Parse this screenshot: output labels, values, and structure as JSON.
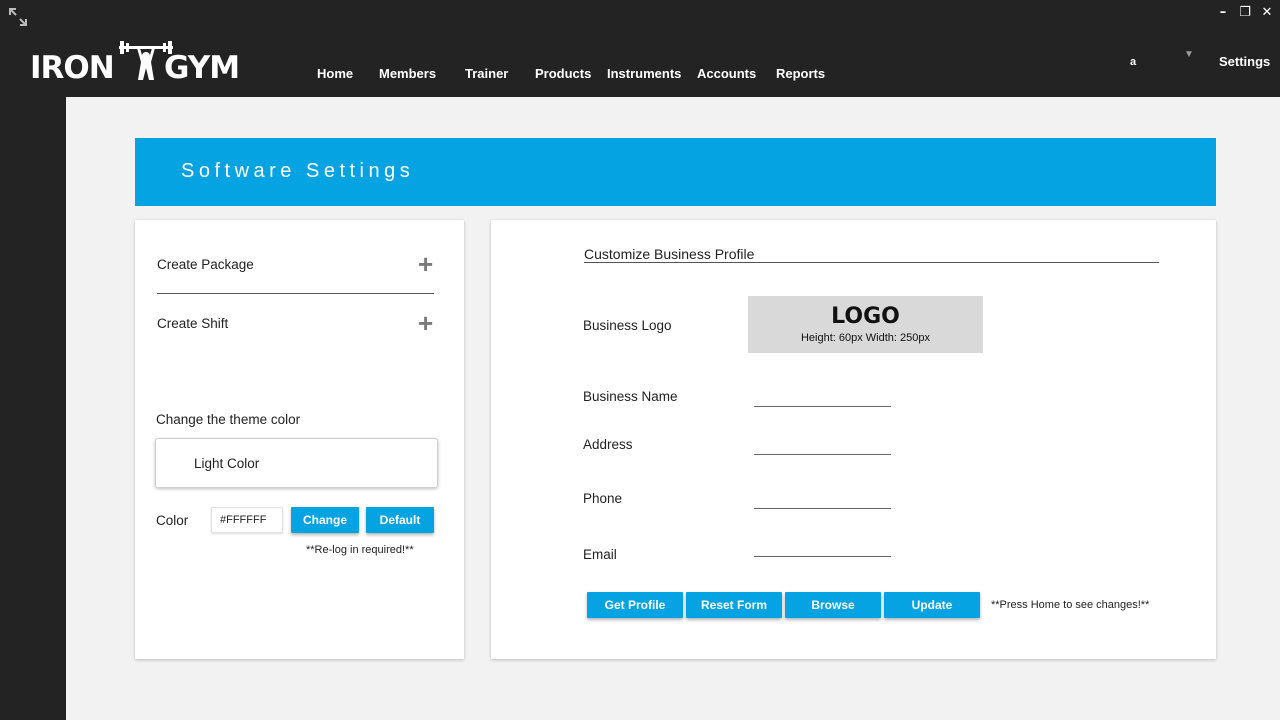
{
  "app": {
    "brand": "IRON GYM",
    "brand_left": "IRON",
    "brand_right": "GYM"
  },
  "window": {
    "minimize": "–",
    "restore": "❐",
    "close": "✕"
  },
  "nav": {
    "items": [
      {
        "label": "Home"
      },
      {
        "label": "Members"
      },
      {
        "label": "Trainer"
      },
      {
        "label": "Products"
      },
      {
        "label": "Instruments"
      },
      {
        "label": "Accounts"
      },
      {
        "label": "Reports"
      }
    ]
  },
  "user": {
    "name": "a",
    "dropdown": "▼"
  },
  "settings_link": "Settings",
  "page": {
    "title": "Software Settings"
  },
  "left_panel": {
    "create_package": "Create Package",
    "create_shift": "Create Shift",
    "plus": "+",
    "theme_heading": "Change the theme color",
    "theme_option": "Light Color",
    "color_label": "Color",
    "color_value": "#FFFFFF",
    "change_button": "Change",
    "default_button": "Default",
    "relog_note": "**Re-log in required!**"
  },
  "right_panel": {
    "heading": "Customize Business Profile",
    "logo_label": "Business Logo",
    "logo_title": "LOGO",
    "logo_size": "Height: 60px   Width: 250px",
    "business_name_label": "Business Name",
    "address_label": "Address",
    "phone_label": "Phone",
    "email_label": "Email",
    "buttons": {
      "get_profile": "Get Profile",
      "reset_form": "Reset Form",
      "browse": "Browse",
      "update": "Update"
    },
    "home_note": "**Press Home to see changes!**"
  },
  "colors": {
    "accent": "#05a3e2",
    "topbar": "#232323",
    "background": "#f2f2f2"
  }
}
